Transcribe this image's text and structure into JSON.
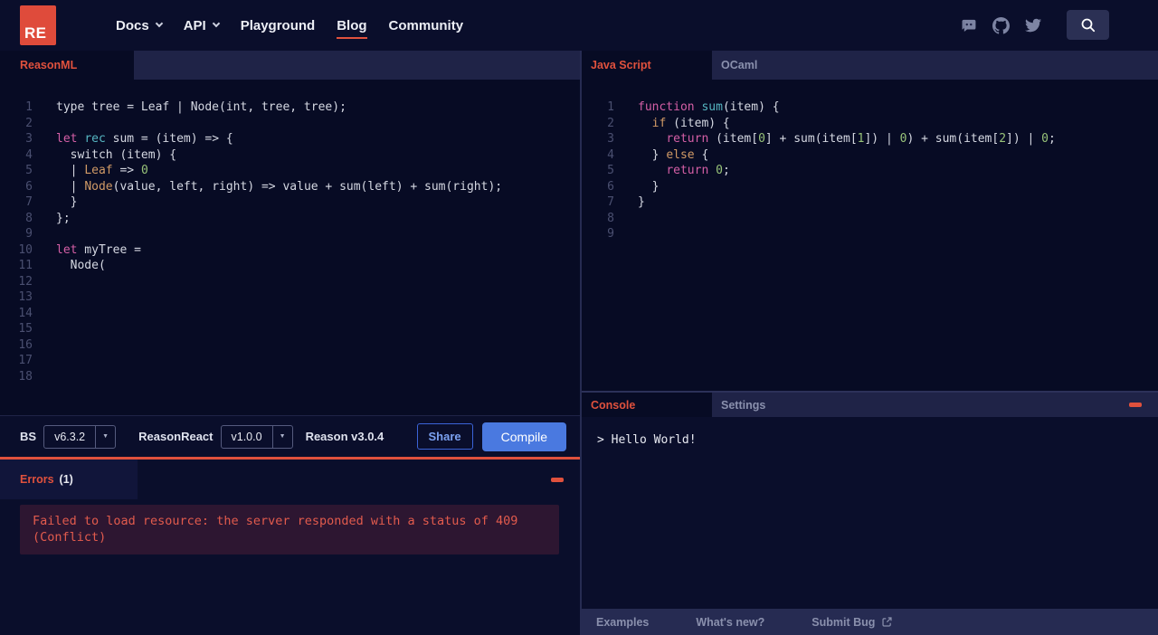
{
  "colors": {
    "accent_red": "#e0513d",
    "logo_red": "#df4b3b",
    "compile_blue": "#4a79e0",
    "error_bg": "#2d1631",
    "error_text": "#e25b4d",
    "panel_dark": "#070b24",
    "bar_light": "#1f2347"
  },
  "nav": {
    "logo": "RE",
    "items": [
      {
        "label": "Docs"
      },
      {
        "label": "API"
      },
      {
        "label": "Playground"
      },
      {
        "label": "Blog"
      },
      {
        "label": "Community"
      }
    ]
  },
  "left": {
    "tab": "ReasonML",
    "lines": [
      [
        [
          "type tree = Leaf | Node(int, tree, tree);",
          "p"
        ]
      ],
      [],
      [
        [
          "let",
          "kw"
        ],
        [
          " ",
          "p"
        ],
        [
          "rec",
          "cy"
        ],
        [
          " sum = (item) => {",
          "p"
        ]
      ],
      [
        [
          "  switch (item) {",
          "p"
        ]
      ],
      [
        [
          "  | ",
          "p"
        ],
        [
          "Leaf",
          "or"
        ],
        [
          " => ",
          "p"
        ],
        [
          "0",
          "gr"
        ]
      ],
      [
        [
          "  | ",
          "p"
        ],
        [
          "Node",
          "or"
        ],
        [
          "(value, left, right) => value + sum(left) + sum(right);",
          "p"
        ]
      ],
      [
        [
          "  }",
          "p"
        ]
      ],
      [
        [
          "};",
          "p"
        ]
      ],
      [],
      [
        [
          "let",
          "kw"
        ],
        [
          " myTree =",
          "p"
        ]
      ],
      [
        [
          "  Node(",
          "p"
        ]
      ],
      [],
      [],
      [],
      [],
      [],
      [],
      []
    ],
    "toolbar": {
      "bs_label": "BS",
      "bs_version": "v6.3.2",
      "reasonreact_label": "ReasonReact",
      "reasonreact_version": "v1.0.0",
      "reason_version": "Reason v3.0.4",
      "share": "Share",
      "compile": "Compile"
    },
    "errors": {
      "title": "Errors",
      "count": "(1)",
      "message": "Failed to load resource: the server responded with a status of 409 (Conflict)"
    }
  },
  "right": {
    "tab_js": "Java Script",
    "tab_ocaml": "OCaml",
    "lines": [
      [
        [
          "function",
          "kw"
        ],
        [
          " ",
          "p"
        ],
        [
          "sum",
          "cy"
        ],
        [
          "(item) {",
          "p"
        ]
      ],
      [
        [
          "  ",
          "p"
        ],
        [
          "if",
          "or"
        ],
        [
          " (item) {",
          "p"
        ]
      ],
      [
        [
          "    ",
          "p"
        ],
        [
          "return",
          "kw"
        ],
        [
          " (item[",
          "p"
        ],
        [
          "0",
          "gr"
        ],
        [
          "] + sum(item[",
          "p"
        ],
        [
          "1",
          "gr"
        ],
        [
          "]) | ",
          "p"
        ],
        [
          "0",
          "gr"
        ],
        [
          ") + sum(item[",
          "p"
        ],
        [
          "2",
          "gr"
        ],
        [
          "]) | ",
          "p"
        ],
        [
          "0",
          "gr"
        ],
        [
          ";",
          "p"
        ]
      ],
      [
        [
          "  } ",
          "p"
        ],
        [
          "else",
          "or"
        ],
        [
          " {",
          "p"
        ]
      ],
      [
        [
          "    ",
          "p"
        ],
        [
          "return",
          "kw"
        ],
        [
          " ",
          "p"
        ],
        [
          "0",
          "gr"
        ],
        [
          ";",
          "p"
        ]
      ],
      [
        [
          "  }",
          "p"
        ]
      ],
      [
        [
          "}",
          "p"
        ]
      ],
      [],
      []
    ],
    "console": {
      "tab_console": "Console",
      "tab_settings": "Settings",
      "output": "> Hello World!"
    },
    "footer": {
      "examples": "Examples",
      "whats_new": "What's new?",
      "submit_bug": "Submit Bug"
    }
  }
}
